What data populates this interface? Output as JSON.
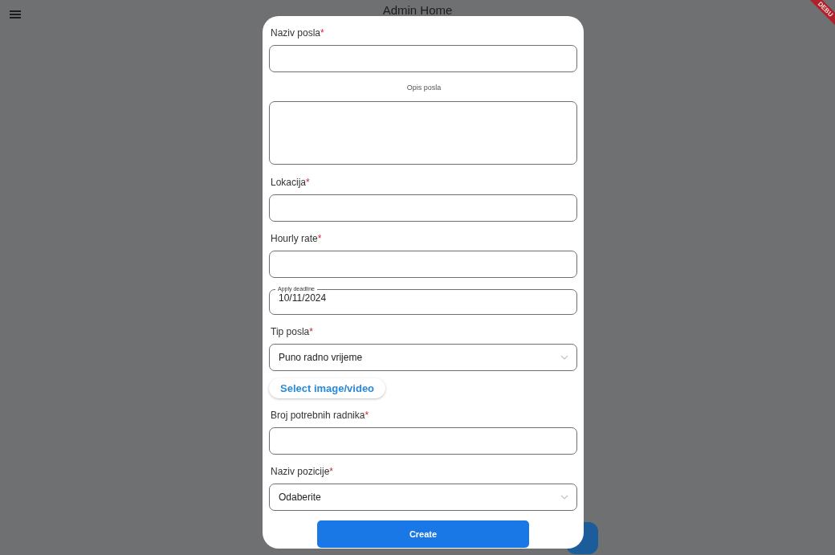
{
  "app_bar": {
    "title": "Admin Home",
    "debug_banner": "DEBU"
  },
  "dialog": {
    "fields": [
      {
        "kind": "text",
        "label": "Naziv posla",
        "asterisk": "*"
      },
      {
        "kind": "textarea",
        "label": "Opis posla"
      },
      {
        "kind": "text",
        "label": "Lokacija",
        "asterisk": "*"
      },
      {
        "kind": "text",
        "label": "Hourly rate",
        "asterisk": "*"
      },
      {
        "kind": "date",
        "label": "Apply deadline",
        "value": "10/11/2024"
      },
      {
        "kind": "select",
        "label": "Tip posla",
        "asterisk": "*",
        "value": "Puno radno vrijeme"
      },
      {
        "kind": "button",
        "label": "Select image/video"
      },
      {
        "kind": "text",
        "label": "Broj potrebnih radnika",
        "asterisk": "*"
      },
      {
        "kind": "select",
        "label": "Naziv pozicije",
        "asterisk": "*",
        "value": "Odaberite"
      }
    ],
    "submit": "Create"
  }
}
